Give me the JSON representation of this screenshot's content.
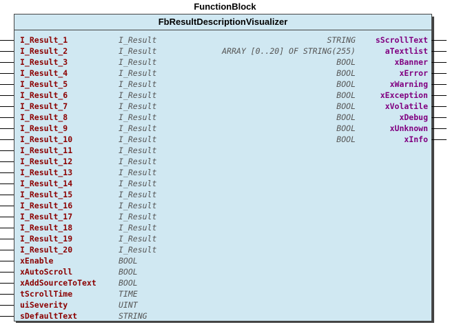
{
  "diagram": {
    "title": "FunctionBlock",
    "block_name": "FbResultDescriptionVisualizer",
    "inputs": [
      {
        "name": "I_Result_1",
        "type": "I_Result"
      },
      {
        "name": "I_Result_2",
        "type": "I_Result"
      },
      {
        "name": "I_Result_3",
        "type": "I_Result"
      },
      {
        "name": "I_Result_4",
        "type": "I_Result"
      },
      {
        "name": "I_Result_5",
        "type": "I_Result"
      },
      {
        "name": "I_Result_6",
        "type": "I_Result"
      },
      {
        "name": "I_Result_7",
        "type": "I_Result"
      },
      {
        "name": "I_Result_8",
        "type": "I_Result"
      },
      {
        "name": "I_Result_9",
        "type": "I_Result"
      },
      {
        "name": "I_Result_10",
        "type": "I_Result"
      },
      {
        "name": "I_Result_11",
        "type": "I_Result"
      },
      {
        "name": "I_Result_12",
        "type": "I_Result"
      },
      {
        "name": "I_Result_13",
        "type": "I_Result"
      },
      {
        "name": "I_Result_14",
        "type": "I_Result"
      },
      {
        "name": "I_Result_15",
        "type": "I_Result"
      },
      {
        "name": "I_Result_16",
        "type": "I_Result"
      },
      {
        "name": "I_Result_17",
        "type": "I_Result"
      },
      {
        "name": "I_Result_18",
        "type": "I_Result"
      },
      {
        "name": "I_Result_19",
        "type": "I_Result"
      },
      {
        "name": "I_Result_20",
        "type": "I_Result"
      },
      {
        "name": "xEnable",
        "type": "BOOL"
      },
      {
        "name": "xAutoScroll",
        "type": "BOOL"
      },
      {
        "name": "xAddSourceToText",
        "type": "BOOL"
      },
      {
        "name": "tScrollTime",
        "type": "TIME"
      },
      {
        "name": "uiSeverity",
        "type": "UINT"
      },
      {
        "name": "sDefaultText",
        "type": "STRING"
      }
    ],
    "outputs": [
      {
        "name": "sScrollText",
        "type": "STRING"
      },
      {
        "name": "aTextlist",
        "type": "ARRAY [0..20] OF STRING(255)"
      },
      {
        "name": "xBanner",
        "type": "BOOL"
      },
      {
        "name": "xError",
        "type": "BOOL"
      },
      {
        "name": "xWarning",
        "type": "BOOL"
      },
      {
        "name": "xException",
        "type": "BOOL"
      },
      {
        "name": "xVolatile",
        "type": "BOOL"
      },
      {
        "name": "xDebug",
        "type": "BOOL"
      },
      {
        "name": "xUnknown",
        "type": "BOOL"
      },
      {
        "name": "xInfo",
        "type": "BOOL"
      }
    ]
  },
  "colors": {
    "block_fill": "#d0e8f2",
    "input_name": "#8b0000",
    "output_name": "#800080",
    "type_text": "#555555",
    "shadow": "#444444"
  }
}
